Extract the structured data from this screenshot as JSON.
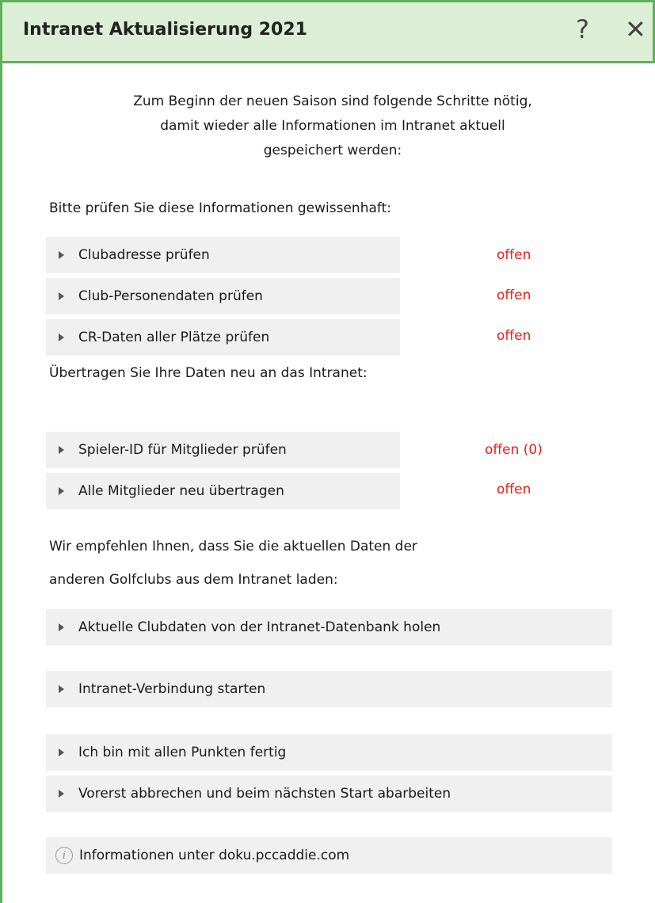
{
  "window": {
    "title": "Intranet Aktualisierung 2021",
    "help_icon": "help-icon",
    "close_icon": "close-icon",
    "accent_color": "#5fb05a"
  },
  "intro": {
    "line1": "Zum Beginn der neuen Saison sind folgende Schritte nötig,",
    "line2": "damit wieder alle Informationen im Intranet aktuell",
    "line3": "gespeichert werden:"
  },
  "section1": {
    "label": "Bitte prüfen Sie diese Informationen gewissenhaft:",
    "items": [
      {
        "label": "Clubadresse prüfen",
        "status": "offen"
      },
      {
        "label": "Club-Personendaten prüfen",
        "status": "offen"
      },
      {
        "label": "CR-Daten aller Plätze prüfen",
        "status": "offen"
      }
    ]
  },
  "section2": {
    "label": "Übertragen Sie Ihre Daten neu an das Intranet:",
    "items": [
      {
        "label": "Spieler-ID für Mitglieder prüfen",
        "status": "offen (0)"
      },
      {
        "label": "Alle Mitglieder neu übertragen",
        "status": "offen"
      }
    ]
  },
  "section3": {
    "label_line1": "Wir empfehlen Ihnen, dass Sie die aktuellen Daten der",
    "label_line2": "anderen Golfclubs aus dem Intranet laden:",
    "items": [
      {
        "label": "Aktuelle Clubdaten von der Intranet-Datenbank holen"
      },
      {
        "label": "Intranet-Verbindung starten"
      }
    ]
  },
  "actions": {
    "done": "Ich bin mit allen Punkten fertig",
    "cancel": "Vorerst abbrechen und beim nächsten Start abarbeiten",
    "info": "Informationen unter doku.pccaddie.com",
    "info_icon": "info-icon"
  },
  "status_color": "#e0231b"
}
